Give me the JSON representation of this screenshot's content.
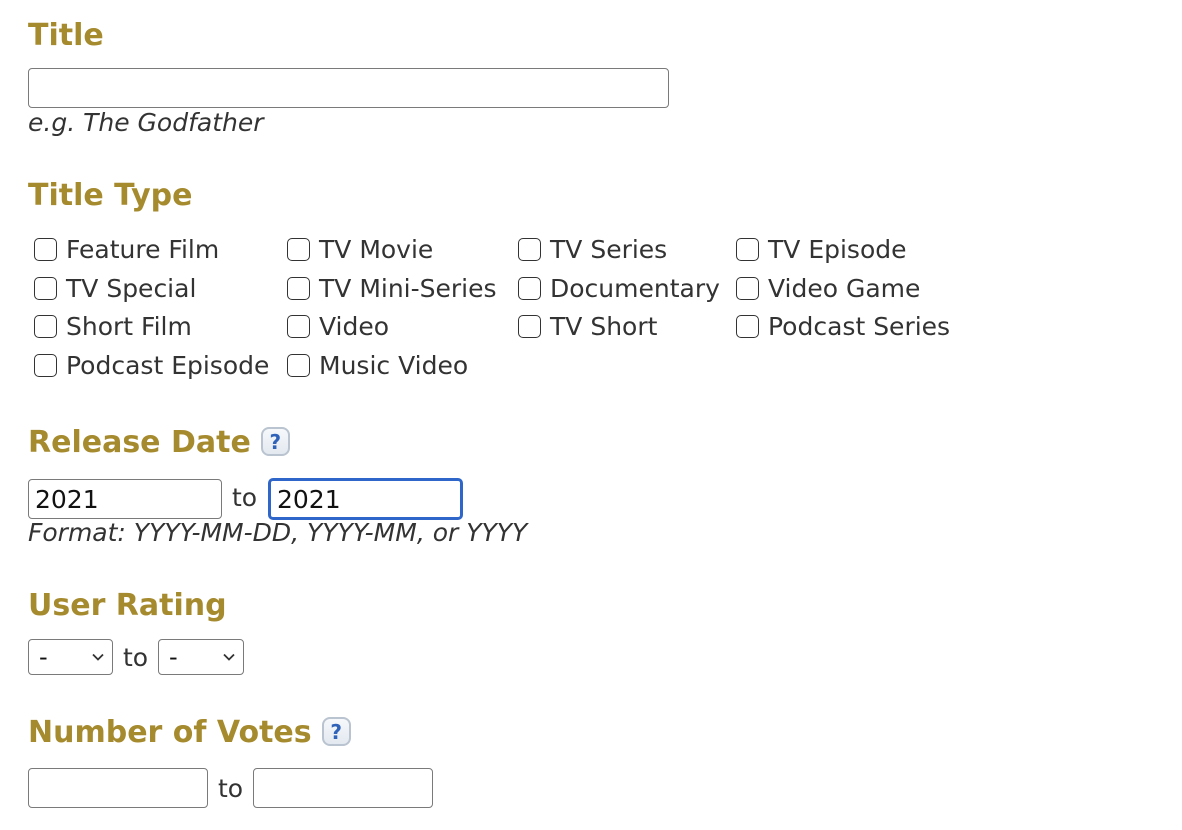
{
  "title_section": {
    "heading": "Title",
    "input_value": "",
    "hint": "e.g. The Godfather"
  },
  "title_type": {
    "heading": "Title Type",
    "options": [
      "Feature Film",
      "TV Movie",
      "TV Series",
      "TV Episode",
      "TV Special",
      "TV Mini-Series",
      "Documentary",
      "Video Game",
      "Short Film",
      "Video",
      "TV Short",
      "Podcast Series",
      "Podcast Episode",
      "Music Video"
    ]
  },
  "release_date": {
    "heading": "Release Date",
    "help_glyph": "?",
    "from_value": "2021",
    "to_label": "to",
    "to_value": "2021",
    "hint": "Format: YYYY-MM-DD, YYYY-MM, or YYYY"
  },
  "user_rating": {
    "heading": "User Rating",
    "from_value": "-",
    "to_label": "to",
    "to_value": "-"
  },
  "num_votes": {
    "heading": "Number of Votes",
    "help_glyph": "?",
    "from_value": "",
    "to_label": "to",
    "to_value": ""
  },
  "colors": {
    "heading": "#A68A2E",
    "focus": "#2F66C9",
    "help_icon": "#2F62B8"
  },
  "icons": {
    "help": "help-question-icon",
    "dropdown": "chevron-down-icon"
  }
}
